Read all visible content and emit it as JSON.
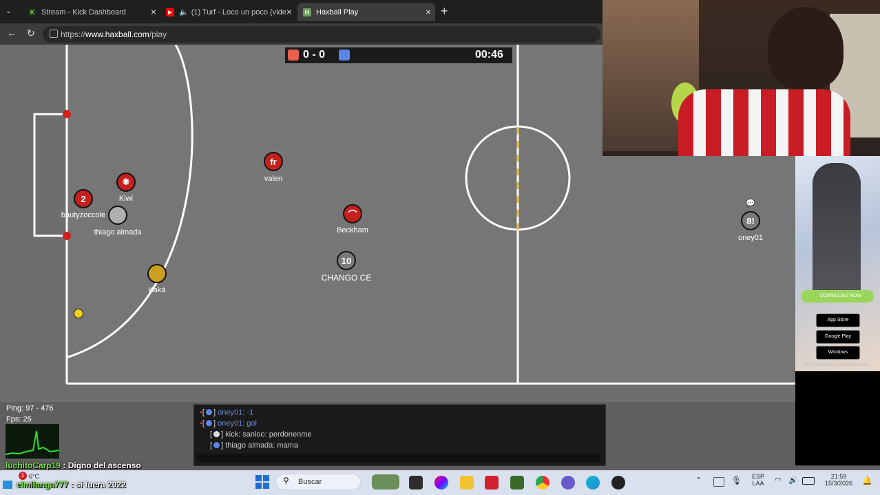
{
  "browser": {
    "tabs": [
      {
        "label": "Stream - Kick Dashboard",
        "favicon": "K",
        "color": "#53fc18"
      },
      {
        "label": "(1) Turf - Loco un poco (video",
        "favicon": "▶",
        "color": "#ff0000"
      },
      {
        "label": "Haxball Play",
        "favicon": "H",
        "color": "#6a9a5a"
      }
    ],
    "url_prefix": "https://",
    "url_host": "www.haxball.com",
    "url_path": "/play"
  },
  "game": {
    "score": "0 - 0",
    "timer": "00:46",
    "red_color": "#e8604c",
    "blue_color": "#5b86e5",
    "players": [
      {
        "name": "bautyzoccole",
        "avatar": "2",
        "team": "red"
      },
      {
        "name": "Kiwi",
        "avatar": "❋",
        "team": "red"
      },
      {
        "name": "thiago almada",
        "avatar": "",
        "team": "red"
      },
      {
        "name": "valen",
        "avatar": "fr",
        "team": "red"
      },
      {
        "name": "Beckham",
        "avatar": "⌒",
        "team": "red"
      },
      {
        "name": "Kaká",
        "avatar": "",
        "team": "red"
      },
      {
        "name": "CHANGO CE",
        "avatar": "10",
        "team": "gray"
      },
      {
        "name": "oney01",
        "avatar": "8!",
        "team": "gray"
      }
    ],
    "chat": [
      {
        "text": "oney01: -1",
        "style": "blue"
      },
      {
        "text": "oney01: gol",
        "style": "blue"
      },
      {
        "text": "kick: sanloo: perdonenme",
        "style": "white"
      },
      {
        "text": "thiago almada: mama",
        "style": "white"
      }
    ],
    "ping": "Ping: 97 - 476",
    "fps": "Fps: 25"
  },
  "stream_overlay": {
    "line1_user": "luchitoCarp19",
    "line1_msg": ": Digno del ascenso",
    "line2_user": "elmilanga777",
    "line2_msg": ": si fuera 2022"
  },
  "ad": {
    "download": "DOWNLOAD NOW",
    "stores": [
      "App Store",
      "Google Play",
      "Windows"
    ],
    "footer": "HOYO-GAMES. ALL RIGHTS RESERVED."
  },
  "taskbar": {
    "temp": "6°C",
    "search": "Buscar",
    "lang1": "ESP",
    "lang2": "LAA",
    "time": "21:59",
    "date": "15/3/2026"
  }
}
